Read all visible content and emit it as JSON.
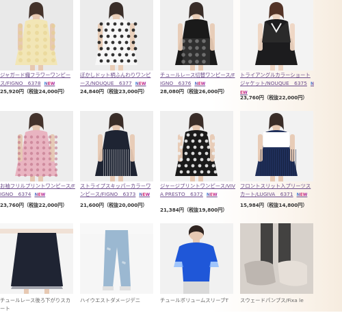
{
  "products": [
    {
      "title": "ジャガード織フラワーワンピース/FIGNO　6378",
      "new": "NEW",
      "price": "25,920円（税抜24,000円）",
      "colors": {
        "bg": "#e9e9e9",
        "dress": "#f2e6b6",
        "accent": "#e6d08a",
        "skin": "#e7c8b0",
        "hair": "#3b2a23"
      }
    },
    {
      "title": "ぼかしドット柄ふんわりワンピース/NOUQUE　6377",
      "new": "NEW",
      "price": "24,840円（税抜23,000円）",
      "colors": {
        "bg": "#ececec",
        "dress": "#f7f7f7",
        "accent": "#1d1d1d",
        "skin": "#e9cdb7",
        "hair": "#2f2420"
      }
    },
    {
      "title": "チュールレース切替ワンピース/FIGNO　6376",
      "new": "NEW",
      "price": "28,080円（税抜26,000円）",
      "colors": {
        "bg": "#efefef",
        "dress": "#1a1a1a",
        "accent": "#bdbdbd",
        "skin": "#e7cab4",
        "hair": "#2e2320"
      }
    },
    {
      "title": "トライアングルカラーショートジャケット/NOUQUE　6375",
      "new": "NEW",
      "price": "23,760円（税抜22,000円）",
      "colors": {
        "bg": "#f3f3f3",
        "dress": "#1c1c1e",
        "accent": "#2a2a2a",
        "skin": "#eed5c2",
        "hair": "#4a2a1d"
      }
    },
    {
      "title": "お袖フリルプリントワンピース/FIGNO　6374",
      "new": "NEW",
      "price": "23,760円（税抜22,000円）",
      "colors": {
        "bg": "#ededed",
        "dress": "#e9b4c1",
        "accent": "#b96a82",
        "skin": "#e6c8b3",
        "hair": "#3a2a24"
      }
    },
    {
      "title": "ストライプスキッパーカラーワンピース/FIGNO　6373",
      "new": "NEW",
      "price": "21,600円（税抜20,000円）",
      "colors": {
        "bg": "#eeeeee",
        "dress": "#1e2433",
        "accent": "#d9d9d9",
        "skin": "#e7c9b3",
        "hair": "#2f2420"
      }
    },
    {
      "title": "ジャージプリントワンピース/VIVA PRESTO　6372",
      "new": "NEW",
      "price": "21,384円（税抜19,800円）",
      "colors": {
        "bg": "#efefef",
        "dress": "#1a1a1a",
        "accent": "#f0f0f0",
        "skin": "#e7c9b3",
        "hair": "#2f2420"
      }
    },
    {
      "title": "フロントスリット入プリーツスカート/LUGIVA　6371",
      "new": "NEW",
      "price": "15,984円（税抜14,800円）",
      "colors": {
        "bg": "#f2f2f2",
        "dress": "#1f2f5a",
        "accent": "#ffffff",
        "skin": "#e7c9b3",
        "hair": "#2f2420"
      }
    },
    {
      "title": "チュールレース後ろ下がりスカート",
      "new": "",
      "price": "",
      "colors": {
        "bg": "#f4f4f4",
        "dress": "#1f2433",
        "accent": "#6a6f7f",
        "skin": "#e7c9b3",
        "hair": "#2f2420"
      }
    },
    {
      "title": "ハイウエストダメージデニ",
      "new": "",
      "price": "",
      "colors": {
        "bg": "#f6f6f6",
        "dress": "#9bb8d1",
        "accent": "#c8d8e5",
        "skin": "#e7c9b3",
        "hair": "#2f2420"
      }
    },
    {
      "title": "チュールボリュームスリーブT",
      "new": "",
      "price": "",
      "colors": {
        "bg": "#f1f1f1",
        "dress": "#1f57d8",
        "accent": "#7db2ff",
        "skin": "#e7c9b3",
        "hair": "#2f2420"
      }
    },
    {
      "title": "スウェードパンプス/Fixa le",
      "new": "",
      "price": "",
      "colors": {
        "bg": "#d7d1cb",
        "dress": "#bdb6b0",
        "accent": "#e6dfd8",
        "skin": "#e7c9b3",
        "hair": "#2f2420"
      }
    }
  ]
}
